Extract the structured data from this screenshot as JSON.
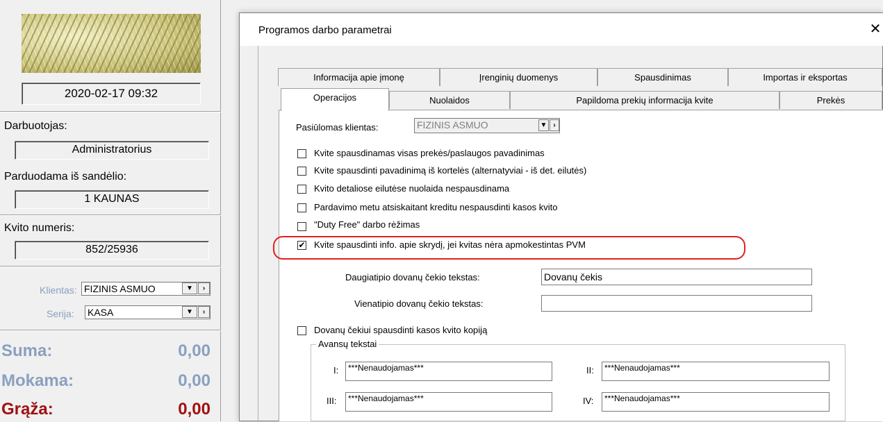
{
  "left_panel": {
    "datetime": "2020-02-17 09:32",
    "employee_label": "Darbuotojas:",
    "employee_value": "Administratorius",
    "warehouse_label": "Parduodama iš sandėlio:",
    "warehouse_value": "1 KAUNAS",
    "receipt_label": "Kvito numeris:",
    "receipt_value": "852/25936",
    "client_label": "Klientas:",
    "client_value": "FIZINIS ASMUO",
    "series_label": "Serija:",
    "series_value": "KASA",
    "combo_arrow": "▼",
    "combo_next": "›",
    "sum_label": "Suma:",
    "sum_value": "0,00",
    "pay_label": "Mokama:",
    "pay_value": "0,00",
    "change_label": "Grąža:",
    "change_value": "0,00"
  },
  "dialog": {
    "title": "Programos darbo parametrai",
    "close": "✕",
    "tabs_row1": [
      "Informacija apie įmonę",
      "Įrenginių duomenys",
      "Spausdinimas",
      "Importas ir eksportas"
    ],
    "tabs_row2": [
      "Operacijos",
      "Nuolaidos",
      "Papildoma prekių informacija kvite",
      "Prekės"
    ],
    "proposed_client_label": "Pasiūlomas klientas:",
    "proposed_client_value": "FIZINIS ASMUO",
    "checkboxes": [
      {
        "label": "Kvite spausdinamas visas prekės/paslaugos pavadinimas",
        "checked": false
      },
      {
        "label": "Kvite spausdinti pavadinimą iš kortelės (alternatyviai - iš det. eilutės)",
        "checked": false
      },
      {
        "label": "Kvito detaliose eilutėse nuolaida nespausdinama",
        "checked": false
      },
      {
        "label": "Pardavimo metu atsiskaitant kreditu nespausdinti kasos kvito",
        "checked": false
      },
      {
        "label": "\"Duty Free\" darbo rėžimas",
        "checked": false
      },
      {
        "label": "Kvite spausdinti info. apie skrydį, jei kvitas nėra apmokestintas PVM",
        "checked": true
      }
    ],
    "check_mark": "✔",
    "multi_voucher_label": "Daugiatipio dovanų čekio tekstas:",
    "multi_voucher_value": "Dovanų čekis",
    "single_voucher_label": "Vienatipio dovanų čekio tekstas:",
    "single_voucher_value": "",
    "copy_checkbox": {
      "label": "Dovanų čekiui spausdinti kasos kvito kopiją",
      "checked": false
    },
    "advance_group_title": "Avansų tekstai",
    "advance": [
      {
        "label": "I:",
        "value": "***Nenaudojamas***"
      },
      {
        "label": "II:",
        "value": "***Nenaudojamas***"
      },
      {
        "label": "III:",
        "value": "***Nenaudojamas***"
      },
      {
        "label": "IV:",
        "value": "***Nenaudojamas***"
      }
    ]
  },
  "colors": {
    "change_label": "#a01010",
    "sum_label": "#8aa0c0",
    "highlight": "#e02020"
  }
}
